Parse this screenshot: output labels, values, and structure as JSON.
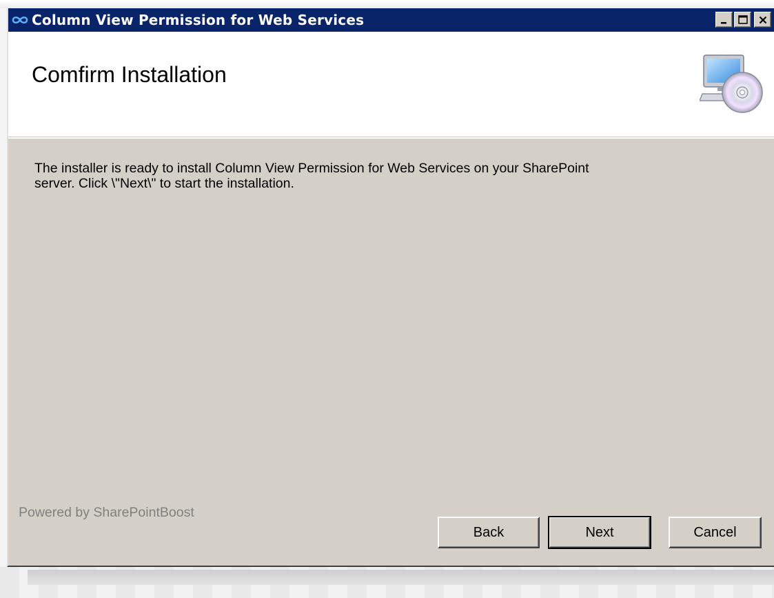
{
  "window": {
    "title": "Column View Permission for Web Services",
    "accent_color": "#0a246a"
  },
  "header": {
    "title": "Comfirm Installation",
    "icon": "computer-cd-icon"
  },
  "body": {
    "line1": "The installer is ready to install Column View Permission for Web Services on your SharePoint",
    "line2": "server. Click \\\"Next\\\" to start the installation."
  },
  "footer": {
    "powered_by": "Powered by SharePointBoost",
    "back_label": "Back",
    "next_label": "Next",
    "cancel_label": "Cancel"
  }
}
